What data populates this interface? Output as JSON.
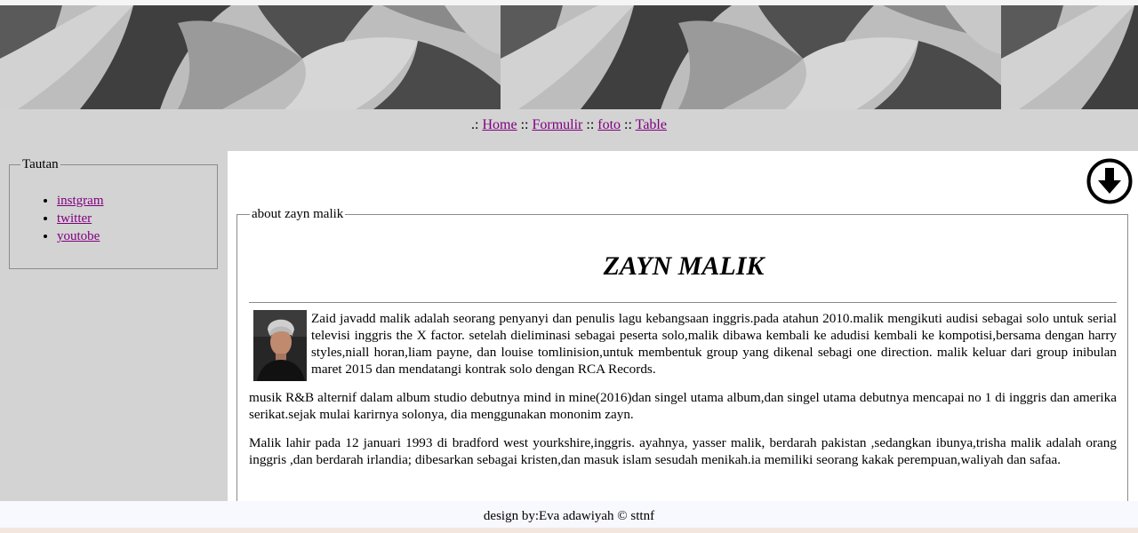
{
  "nav": {
    "prefix": ".:",
    "sep": "::",
    "links": [
      "Home",
      "Formulir",
      "foto",
      "Table"
    ]
  },
  "sidebar": {
    "legend": "Tautan",
    "links": [
      "instgram",
      "twitter",
      "youtobe"
    ]
  },
  "main": {
    "download_icon": "arrow-down-circle-icon",
    "legend": "about zayn malik",
    "title": "ZAYN MALIK",
    "paragraphs": [
      "Zaid javadd malik adalah seorang penyanyi dan penulis lagu kebangsaan inggris.pada atahun 2010.malik mengikuti audisi sebagai solo untuk serial televisi inggris the X factor. setelah dieliminasi sebagai peserta solo,malik dibawa kembali ke adudisi kembali ke kompotisi,bersama dengan harry styles,niall horan,liam payne, dan louise tomlinision,untuk membentuk group yang dikenal sebagi one direction. malik keluar dari group inibulan maret 2015 dan mendatangi kontrak solo dengan RCA Records.",
      "musik R&B alternif dalam album studio debutnya mind in mine(2016)dan singel utama album,dan singel utama debutnya mencapai no 1 di inggris dan amerika serikat.sejak mulai karirnya solonya, dia menggunakan mononim zayn.",
      "Malik lahir pada 12 januari 1993 di bradford west yourkshire,inggris. ayahnya, yasser malik, berdarah pakistan ,sedangkan ibunya,trisha malik adalah orang inggris ,dan berdarah irlandia; dibesarkan sebagai kristen,dan masuk islam sesudah menikah.ia memiliki seorang kakak perempuan,waliyah dan safaa."
    ]
  },
  "footer": {
    "text": "design by:Eva adawiyah © sttnf"
  },
  "colors": {
    "page_bg": "#d3d3d3",
    "content_bg": "#ffffff",
    "link_visited": "#800080",
    "footer_bg": "#f8f8ff"
  }
}
